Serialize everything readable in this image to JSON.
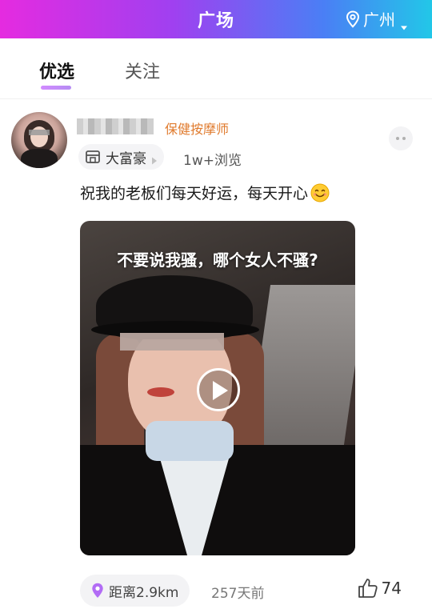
{
  "header": {
    "title": "广场",
    "city": "广州"
  },
  "tabs": [
    {
      "label": "优选",
      "active": true
    },
    {
      "label": "关注",
      "active": false
    }
  ],
  "post": {
    "role": "保健按摩师",
    "tag": "大富豪",
    "views": "1w+浏览",
    "caption": "祝我的老板们每天好运，每天开心",
    "caption_emoji": "smile-icon",
    "video_overlay_text": "不要说我骚，哪个女人不骚?",
    "distance": "距离2.9km",
    "time": "257天前",
    "likes": "74"
  },
  "colors": {
    "header_gradient": [
      "#e52be0",
      "#a040f0",
      "#4a7ff5",
      "#22c7e8"
    ],
    "role": "#e07b2e",
    "tab_indicator": "#c28bf8",
    "location_icon": "#b26cf5"
  }
}
